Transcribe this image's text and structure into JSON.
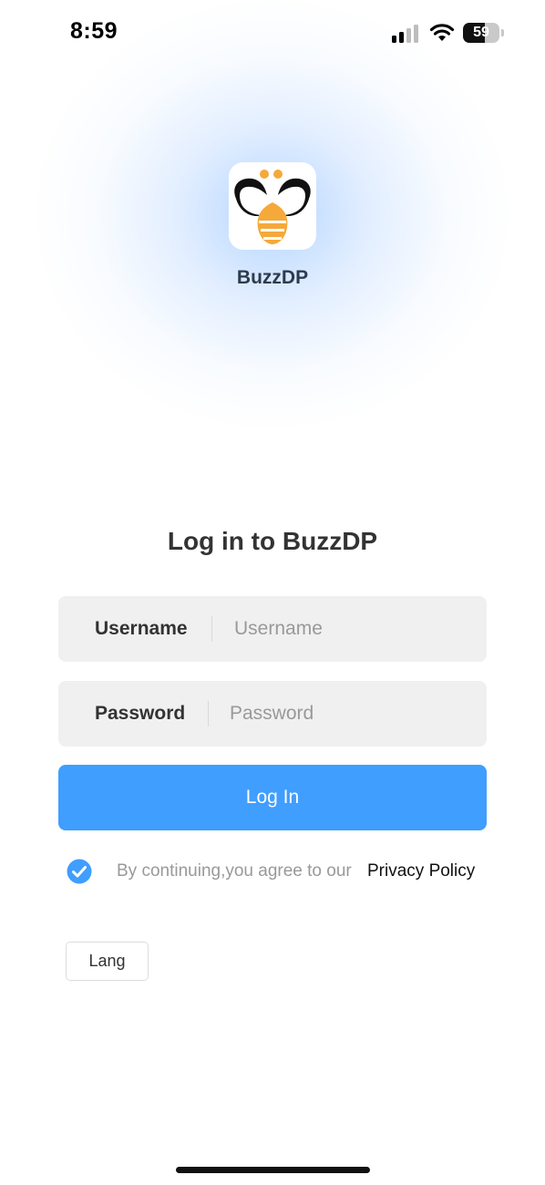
{
  "status_bar": {
    "time": "8:59",
    "battery_level": "59",
    "battery_fraction": 0.59,
    "icons": [
      "signal-icon",
      "wifi-icon",
      "battery-icon"
    ]
  },
  "app": {
    "name": "BuzzDP",
    "logo_icon": "bee-logo-icon"
  },
  "login": {
    "title": "Log in to BuzzDP",
    "username": {
      "label": "Username",
      "placeholder": "Username",
      "value": ""
    },
    "password": {
      "label": "Password",
      "placeholder": "Password",
      "value": ""
    },
    "submit_label": "Log In"
  },
  "agreement": {
    "checked": true,
    "text": "By continuing,you agree to our",
    "link_label": "Privacy Policy"
  },
  "lang_button_label": "Lang",
  "colors": {
    "primary": "#409eff",
    "field_bg": "#f0f0f0",
    "logo_orange": "#f5a93a",
    "text_dark": "#333333",
    "text_muted": "#999999"
  }
}
